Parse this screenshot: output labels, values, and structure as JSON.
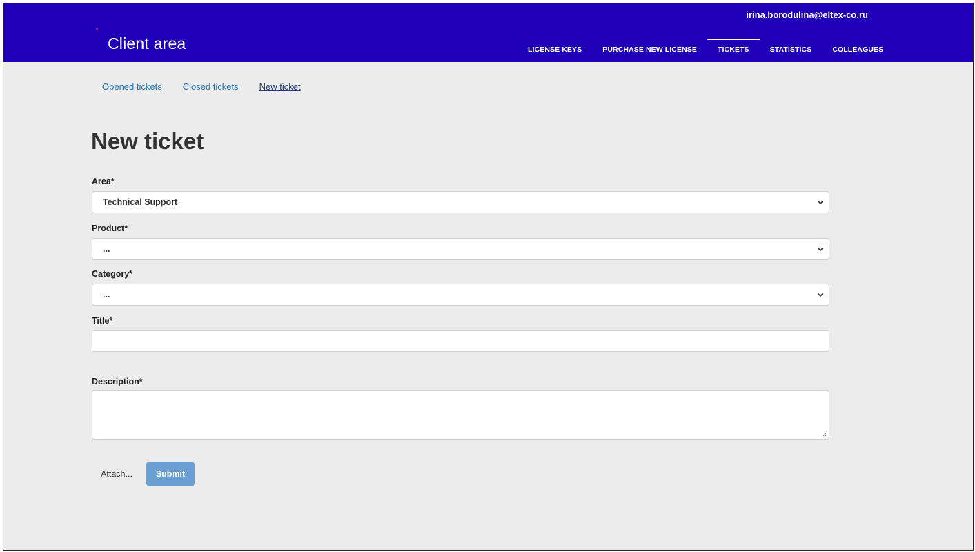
{
  "header": {
    "brand": "Client area",
    "user_email": "irina.borodulina@eltex-co.ru",
    "nav": [
      {
        "label": "LICENSE KEYS"
      },
      {
        "label": "PURCHASE NEW LICENSE"
      },
      {
        "label": "TICKETS"
      },
      {
        "label": "STATISTICS"
      },
      {
        "label": "COLLEAGUES"
      }
    ],
    "active_nav": "TICKETS"
  },
  "subnav": {
    "items": [
      {
        "label": "Opened tickets"
      },
      {
        "label": "Closed tickets"
      },
      {
        "label": "New ticket"
      }
    ],
    "active": "New ticket"
  },
  "page": {
    "title": "New ticket"
  },
  "form": {
    "area": {
      "label": "Area*",
      "value": "Technical Support"
    },
    "product": {
      "label": "Product*",
      "value": "..."
    },
    "category": {
      "label": "Category*",
      "value": "..."
    },
    "title": {
      "label": "Title*",
      "value": ""
    },
    "description": {
      "label": "Description*",
      "value": ""
    },
    "attach_label": "Attach...",
    "submit_label": "Submit"
  },
  "colors": {
    "header_bg": "#1f00b8",
    "link": "#2472b5",
    "submit_bg": "#6b9fd3",
    "page_bg": "#ececec"
  },
  "icons": {
    "select_chevron": "chevron-down-icon",
    "resize_grip": "resize-grip-icon",
    "brand_mark": "red-dot-icon"
  }
}
